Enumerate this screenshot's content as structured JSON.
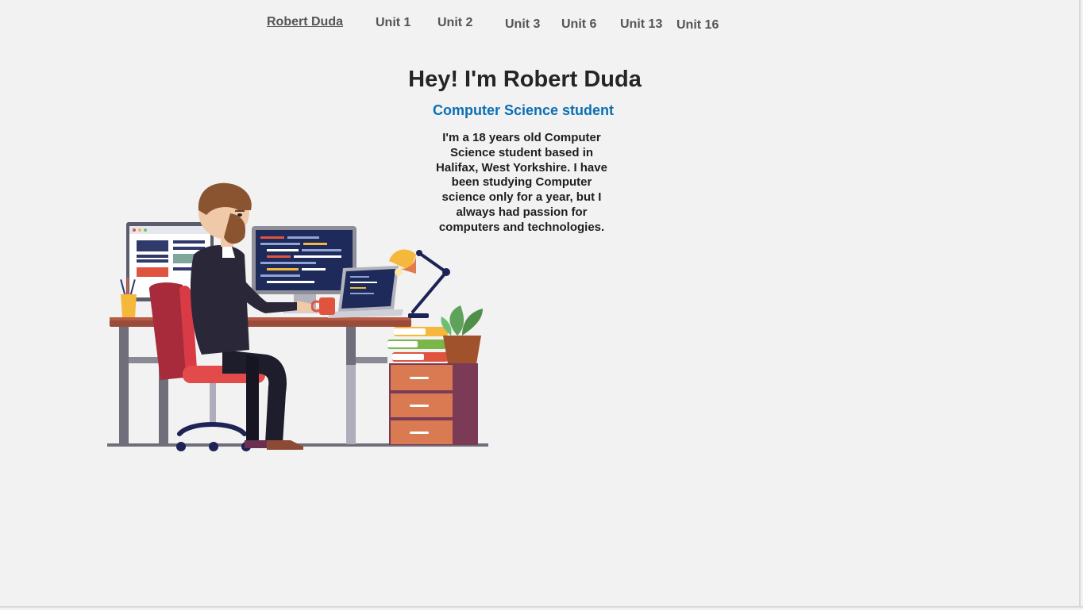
{
  "nav": {
    "home": "Robert Duda",
    "items": [
      "Unit 1",
      "Unit 2",
      "Unit 3",
      "Unit 6",
      "Unit 13",
      "Unit 16"
    ]
  },
  "hero": {
    "title": "Hey! I'm Robert Duda",
    "subtitle": "Computer Science student",
    "bio": "I'm a 18 years old Computer Science student based in Halifax, West Yorkshire. I have been studying Computer science only for a year, but I always had passion for computers and technologies."
  },
  "colors": {
    "background": "#f2f2f2",
    "subtitle": "#0a6fb5",
    "nav_text": "#555555"
  },
  "illustration": {
    "icon": "developer-at-desk-illustration"
  }
}
